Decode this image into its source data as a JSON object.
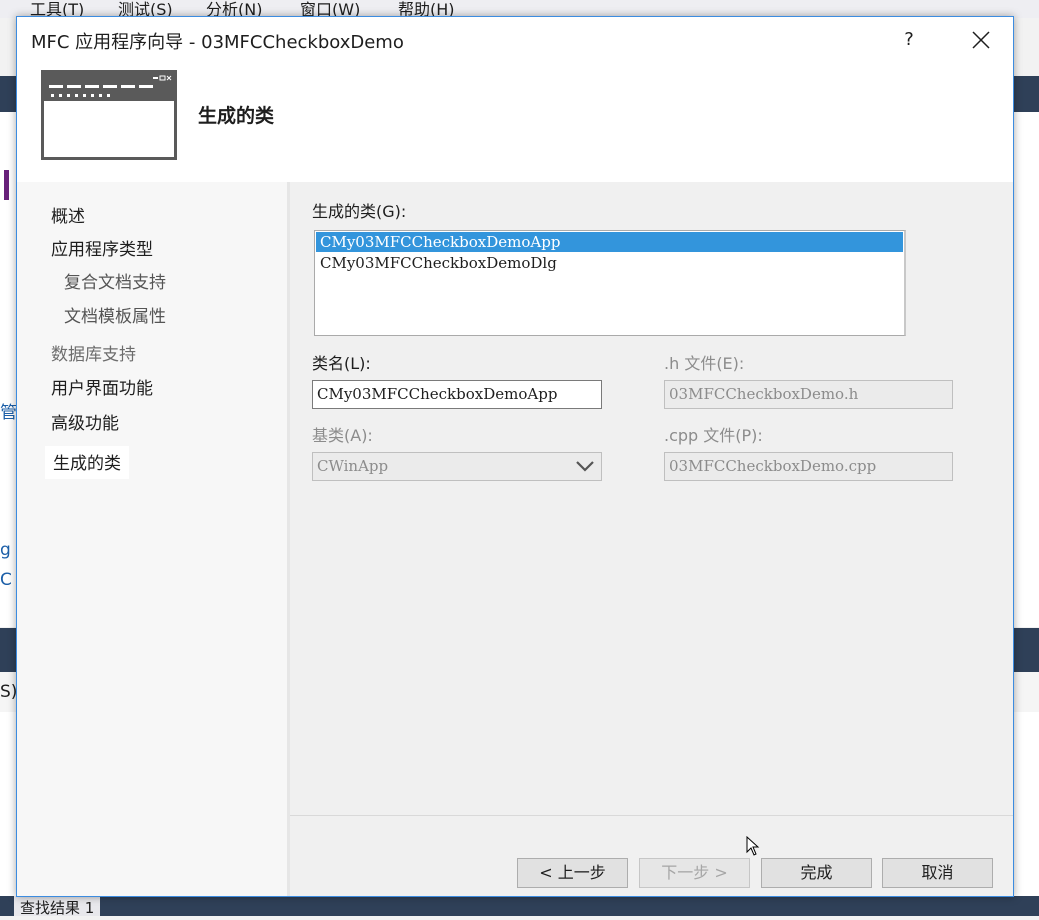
{
  "background_ide": {
    "menu": [
      "工具(T)",
      "测试(S)",
      "分析(N)",
      "窗口(W)",
      "帮助(H)"
    ],
    "side_fragments": [
      "管理",
      "g",
      "C",
      "S):"
    ],
    "bottom_tab": "查找结果 1"
  },
  "dialog": {
    "title": "MFC 应用程序向导 - 03MFCCheckboxDemo",
    "help_glyph": "?",
    "header_title": "生成的类",
    "nav_items": [
      {
        "label": "概述",
        "state": "normal"
      },
      {
        "label": "应用程序类型",
        "state": "normal"
      },
      {
        "label": "复合文档支持",
        "state": "sub"
      },
      {
        "label": "文档模板属性",
        "state": "sub"
      },
      {
        "label": "数据库支持",
        "state": "disabled"
      },
      {
        "label": "用户界面功能",
        "state": "normal"
      },
      {
        "label": "高级功能",
        "state": "normal"
      },
      {
        "label": "生成的类",
        "state": "active"
      }
    ],
    "generated_classes_label": "生成的类(G):",
    "generated_classes": [
      {
        "name": "CMy03MFCCheckboxDemoApp",
        "selected": true
      },
      {
        "name": "CMy03MFCCheckboxDemoDlg",
        "selected": false
      }
    ],
    "class_name_label": "类名(L):",
    "class_name_value": "CMy03MFCCheckboxDemoApp",
    "h_file_label": ".h 文件(E):",
    "h_file_value": "03MFCCheckboxDemo.h",
    "base_class_label": "基类(A):",
    "base_class_value": "CWinApp",
    "cpp_file_label": ".cpp 文件(P):",
    "cpp_file_value": "03MFCCheckboxDemo.cpp",
    "buttons": {
      "back": "< 上一步",
      "next": "下一步 >",
      "finish": "完成",
      "cancel": "取消"
    }
  },
  "colors": {
    "accent_border": "#3c8ce0",
    "selection": "#3395dc",
    "ide_dark": "#2f4058"
  }
}
